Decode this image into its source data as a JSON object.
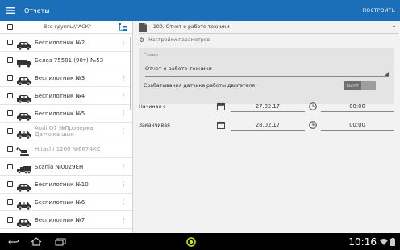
{
  "appbar": {
    "title": "Отчеты",
    "build_label": "ПОСТРОИТЬ"
  },
  "groups": {
    "label": "Все группы\\\"АСК\""
  },
  "vehicles": [
    {
      "name": "Беспилотник №2",
      "icon": "car-icon"
    },
    {
      "name": "Белаз 75581 (90т) №53",
      "icon": "dump-truck-icon"
    },
    {
      "name": "Беспилотник №3",
      "icon": "car-icon"
    },
    {
      "name": "Беспилотник №4",
      "icon": "car-icon"
    },
    {
      "name": "Беспилотник №5",
      "icon": "car-icon"
    },
    {
      "name": "Audi Q7 №Проверка Датчика шин",
      "icon": "car-icon"
    },
    {
      "name": "Hitachi 1200 №6674КС",
      "icon": "excavator-icon"
    },
    {
      "name": "Scania №0029ЕН",
      "icon": "truck-icon"
    },
    {
      "name": "Беспилотник №10",
      "icon": "car-icon"
    },
    {
      "name": "Беспилотник №6",
      "icon": "car-icon"
    },
    {
      "name": "Беспилотник №7",
      "icon": "car-icon"
    }
  ],
  "report": {
    "selected": "100. Отчет о работе техники",
    "params_label": "Настройки параметров"
  },
  "schema": {
    "label": "Схема",
    "value": "Отчет о работе техники",
    "sensor_label": "Срабатывания датчика работы двигателя",
    "toggle_label": "ВЫКЛ"
  },
  "start": {
    "label": "Начиная с",
    "date": "27.02.17",
    "time": "00:00"
  },
  "end": {
    "label": "Заканчивая",
    "date": "28.02.17",
    "time": "00:00"
  },
  "statusbar": {
    "clock": "10:16"
  },
  "colors": {
    "accent": "#1a6fb8",
    "nav_dot": "#c6f000"
  }
}
